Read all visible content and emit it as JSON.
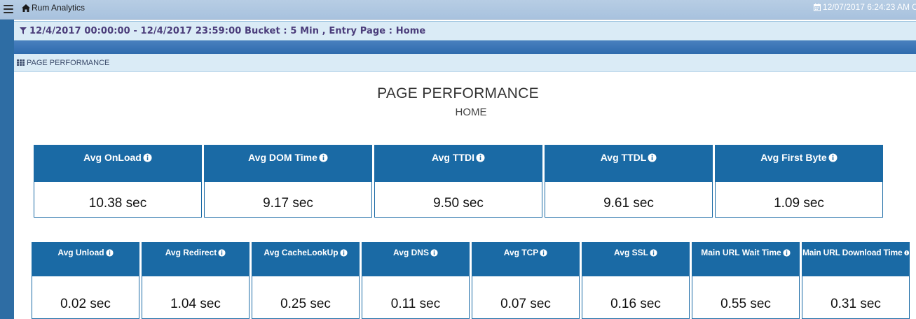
{
  "header": {
    "app_title": "Rum Analytics",
    "datetime": "12/07/2017 6:24:23 AM",
    "trailing": "C"
  },
  "filter": {
    "text": "12/4/2017 00:00:00 - 12/4/2017 23:59:00 Bucket : 5 Min , Entry Page : Home"
  },
  "panel": {
    "header_label": "PAGE PERFORMANCE",
    "title": "PAGE PERFORMANCE",
    "subtitle": "HOME"
  },
  "metrics_primary": [
    {
      "label": "Avg OnLoad",
      "value": "10.38 sec"
    },
    {
      "label": "Avg DOM Time",
      "value": "9.17 sec"
    },
    {
      "label": "Avg TTDI",
      "value": "9.50 sec"
    },
    {
      "label": "Avg TTDL",
      "value": "9.61 sec"
    },
    {
      "label": "Avg First Byte",
      "value": "1.09 sec"
    }
  ],
  "metrics_secondary": [
    {
      "label": "Avg Unload",
      "value": "0.02 sec"
    },
    {
      "label": "Avg Redirect",
      "value": "1.04 sec"
    },
    {
      "label": "Avg CacheLookUp",
      "value": "0.25 sec"
    },
    {
      "label": "Avg DNS",
      "value": "0.11 sec"
    },
    {
      "label": "Avg TCP",
      "value": "0.07 sec"
    },
    {
      "label": "Avg SSL",
      "value": "0.16 sec"
    },
    {
      "label": "Main URL Wait Time",
      "value": "0.55 sec"
    },
    {
      "label": "Main URL Download Time",
      "value": "0.31 sec"
    }
  ],
  "colors": {
    "card_header": "#1a6aa5",
    "filter_text": "#4a3c7a",
    "topbar": "#b7cde4"
  },
  "icons": {
    "menu": "hamburger-icon",
    "home": "home-icon",
    "calendar": "calendar-icon",
    "filter": "filter-icon",
    "grid": "grid-icon",
    "info": "info-icon"
  }
}
